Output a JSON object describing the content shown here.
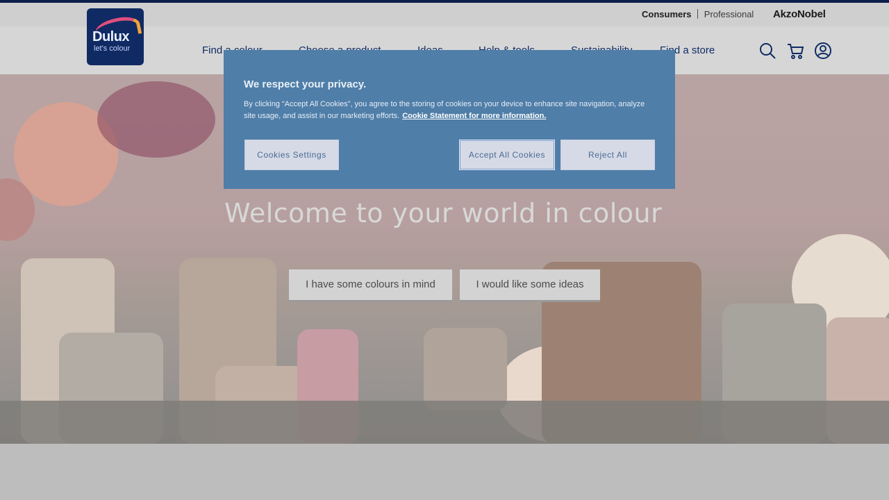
{
  "utility": {
    "consumers": "Consumers",
    "professional": "Professional",
    "akzonobel": "AkzoNobel"
  },
  "logo": {
    "brand": "Dulux",
    "tagline": "let's colour"
  },
  "nav": {
    "items": [
      {
        "label": "Find a colour",
        "has_dropdown": true
      },
      {
        "label": "Choose a product",
        "has_dropdown": true
      },
      {
        "label": "Ideas",
        "has_dropdown": true
      },
      {
        "label": "Help & tools",
        "has_dropdown": true
      },
      {
        "label": "Sustainability",
        "has_dropdown": false
      },
      {
        "label": "Find a store",
        "has_dropdown": false
      }
    ]
  },
  "icons": [
    "search-icon",
    "cart-icon",
    "account-icon"
  ],
  "hero": {
    "title": "Welcome to your world in colour",
    "cta_colours": "I have some colours in mind",
    "cta_ideas": "I would like some ideas"
  },
  "cookie": {
    "title": "We respect your privacy.",
    "text": "By clicking “Accept All Cookies”, you agree to the storing of cookies on your device to enhance site navigation, analyze site usage, and assist in our marketing efforts.",
    "link": "Cookie Statement for more information.",
    "settings_label": "Cookies Settings",
    "accept_label": "Accept All Cookies",
    "reject_label": "Reject All"
  },
  "colors": {
    "navy": "#0f2b64",
    "overlay": "#4f7ea8"
  }
}
